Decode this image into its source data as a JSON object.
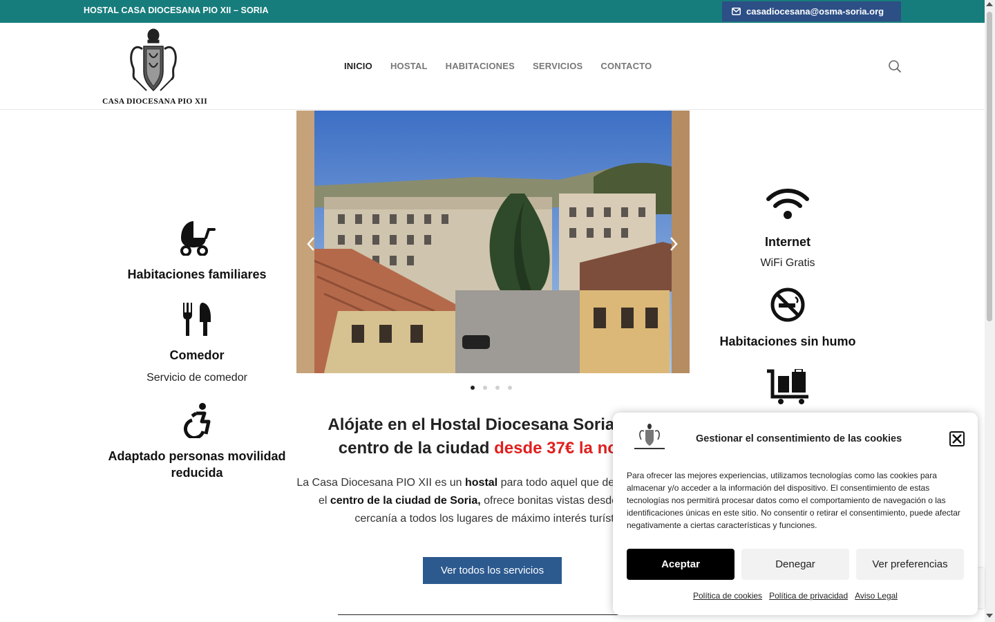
{
  "topbar": {
    "site_name": "HOSTAL CASA DIOCESANA PIO XII – SORIA",
    "email": "casadiocesana@osma-soria.org",
    "email_icon": "envelope-icon"
  },
  "header": {
    "logo_text": "CASA DIOCESANA PIO XII",
    "nav": [
      "INICIO",
      "HOSTAL",
      "HABITACIONES",
      "SERVICIOS",
      "CONTACTO"
    ],
    "active_nav": "INICIO",
    "search_icon": "search-icon"
  },
  "features_left": [
    {
      "icon": "baby-carriage-icon",
      "title": "Habitaciones familiares",
      "desc": ""
    },
    {
      "icon": "utensils-icon",
      "title": "Comedor",
      "desc": "Servicio de comedor"
    },
    {
      "icon": "wheelchair-icon",
      "title": "Adaptado personas movilidad reducida",
      "desc": ""
    }
  ],
  "features_right": [
    {
      "icon": "wifi-icon",
      "title": "Internet",
      "desc": "WiFi Gratis"
    },
    {
      "icon": "no-smoking-icon",
      "title": "Habitaciones sin humo",
      "desc": ""
    },
    {
      "icon": "luggage-cart-icon",
      "title": "",
      "desc": ""
    }
  ],
  "slider": {
    "slide_count": 4,
    "active_slide": 1
  },
  "main": {
    "headline_part1": "Alójate en el Hostal Diocesana Soria en el",
    "headline_part2": "centro de la ciudad ",
    "headline_price": "desde 37€ la noche",
    "intro_1": "La Casa Diocesana PIO XII es un ",
    "intro_b1": "hostal",
    "intro_2": " para todo aquel que desee alojarse en el ",
    "intro_b2": "centro de la ciudad de Soria,",
    "intro_3": " ofrece bonitas vistas desde su ático y cercanía a todos los lugares de máximo interés turístico.",
    "cta": "Ver todos los servicios"
  },
  "cookie": {
    "title": "Gestionar el consentimiento de las cookies",
    "text": "Para ofrecer las mejores experiencias, utilizamos tecnologías como las cookies para almacenar y/o acceder a la información del dispositivo. El consentimiento de estas tecnologías nos permitirá procesar datos como el comportamiento de navegación o las identificaciones únicas en este sitio. No consentir o retirar el consentimiento, puede afectar negativamente a ciertas características y funciones.",
    "accept": "Aceptar",
    "deny": "Denegar",
    "prefs": "Ver preferencias",
    "links": [
      "Política de cookies",
      "Política de privacidad",
      "Aviso Legal"
    ]
  },
  "colors": {
    "topbar": "#177d7c",
    "email_button": "#2c4f86",
    "cta": "#2c5a8f",
    "price": "#e0201f"
  }
}
